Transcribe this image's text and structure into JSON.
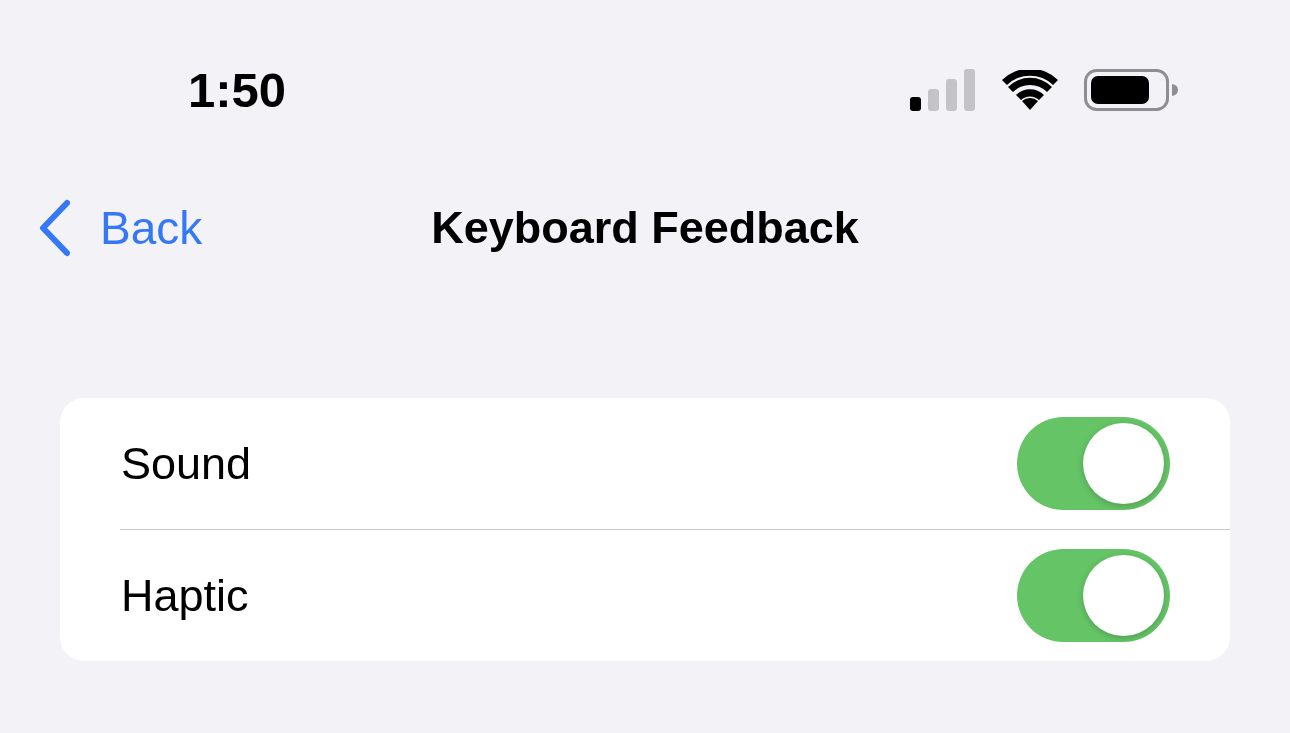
{
  "status_bar": {
    "time": "1:50"
  },
  "nav": {
    "back": "Back",
    "title": "Keyboard Feedback"
  },
  "settings": [
    {
      "label": "Sound",
      "on": true
    },
    {
      "label": "Haptic",
      "on": true
    }
  ]
}
